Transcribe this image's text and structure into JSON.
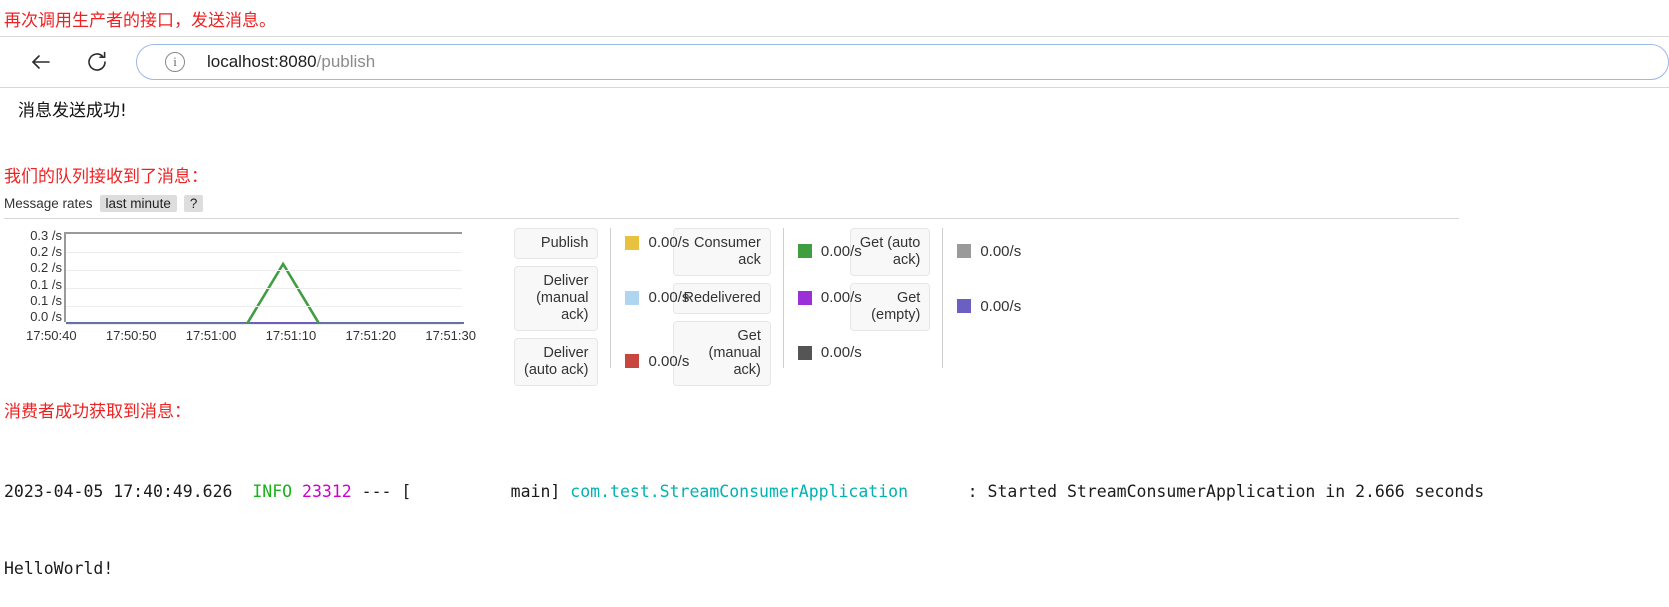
{
  "annotations": {
    "top": "再次调用生产者的接口，发送消息。",
    "queue": "我们的队列接收到了消息：",
    "consumer": "消费者成功获取到消息："
  },
  "browser": {
    "back_label": "←",
    "reload_label": "⟳",
    "info_label": "i",
    "url_host": "localhost:8080",
    "url_path": "/publish"
  },
  "page": {
    "publish_result": "消息发送成功!"
  },
  "rates": {
    "title": "Message rates",
    "period": "last minute",
    "help": "?"
  },
  "chart_data": {
    "type": "line",
    "title": "Message rates",
    "xlabel": "",
    "ylabel": "/s",
    "ylim": [
      0.0,
      0.3
    ],
    "yticks": [
      "0.3 /s",
      "0.2 /s",
      "0.2 /s",
      "0.1 /s",
      "0.1 /s",
      "0.0 /s"
    ],
    "xticks": [
      "17:50:40",
      "17:50:50",
      "17:51:00",
      "17:51:10",
      "17:51:20",
      "17:51:30"
    ],
    "grid": true,
    "legend_position": "right",
    "series": [
      {
        "name": "Publish",
        "color": "#e8c13f",
        "rate": "0.00/s",
        "values": [
          0,
          0,
          0,
          0,
          0,
          0,
          0,
          0,
          0,
          0,
          0,
          0
        ]
      },
      {
        "name": "Deliver (manual ack)",
        "color": "#aed6f1",
        "rate": "0.00/s",
        "values": [
          0,
          0,
          0,
          0,
          0,
          0,
          0,
          0,
          0,
          0,
          0,
          0
        ]
      },
      {
        "name": "Deliver (auto ack)",
        "color": "#c9453f",
        "rate": "0.00/s",
        "values": [
          0,
          0,
          0,
          0,
          0,
          0,
          0,
          0,
          0,
          0,
          0,
          0
        ]
      },
      {
        "name": "Consumer ack",
        "color": "#3f9e3f",
        "rate": "0.00/s",
        "values": [
          0,
          0,
          0,
          0,
          0,
          0,
          0.2,
          0,
          0,
          0,
          0,
          0
        ]
      },
      {
        "name": "Redelivered",
        "color": "#9b30d9",
        "rate": "0.00/s",
        "values": [
          0,
          0,
          0,
          0,
          0,
          0,
          0,
          0,
          0,
          0,
          0,
          0
        ]
      },
      {
        "name": "Get (manual ack)",
        "color": "#555555",
        "rate": "0.00/s",
        "values": [
          0,
          0,
          0,
          0,
          0,
          0,
          0,
          0,
          0,
          0,
          0,
          0
        ]
      },
      {
        "name": "Get (auto ack)",
        "color": "#9a9a9a",
        "rate": "0.00/s",
        "values": [
          0,
          0,
          0,
          0,
          0,
          0,
          0,
          0,
          0,
          0,
          0,
          0
        ]
      },
      {
        "name": "Get (empty)",
        "color": "#6b5fc4",
        "rate": "0.00/s",
        "values": [
          0,
          0,
          0,
          0,
          0,
          0,
          0,
          0,
          0,
          0,
          0,
          0
        ]
      }
    ],
    "peak": {
      "x": "17:51:10",
      "y": 0.2,
      "series": "Consumer ack"
    }
  },
  "legend_groups": [
    {
      "id": "publish",
      "items": [
        {
          "label": "Publish",
          "rate": "0.00/s",
          "color": "#e8c13f"
        },
        {
          "label": "Deliver\n(manual\nack)",
          "rate": "0.00/s",
          "color": "#aed6f1"
        },
        {
          "label": "Deliver\n(auto ack)",
          "rate": "0.00/s",
          "color": "#c9453f"
        }
      ]
    },
    {
      "id": "consumer",
      "items": [
        {
          "label": "Consumer\nack",
          "rate": "0.00/s",
          "color": "#3f9e3f"
        },
        {
          "label": "Redelivered",
          "rate": "0.00/s",
          "color": "#9b30d9"
        },
        {
          "label": "Get\n(manual\nack)",
          "rate": "0.00/s",
          "color": "#555555"
        }
      ]
    },
    {
      "id": "get",
      "items": [
        {
          "label": "Get (auto\nack)",
          "rate": "0.00/s",
          "color": "#9a9a9a"
        },
        {
          "label": "Get\n(empty)",
          "rate": "0.00/s",
          "color": "#6b5fc4"
        }
      ]
    }
  ],
  "console": {
    "line1": {
      "timestamp": "2023-04-05 17:40:49.626",
      "level": "INFO",
      "pid": "23312",
      "sep": "--- [",
      "thread": "          main]",
      "logger": "com.test.StreamConsumerApplication",
      "message": "      : Started StreamConsumerApplication in 2.666 seconds"
    },
    "line2": "HelloWorld!"
  }
}
